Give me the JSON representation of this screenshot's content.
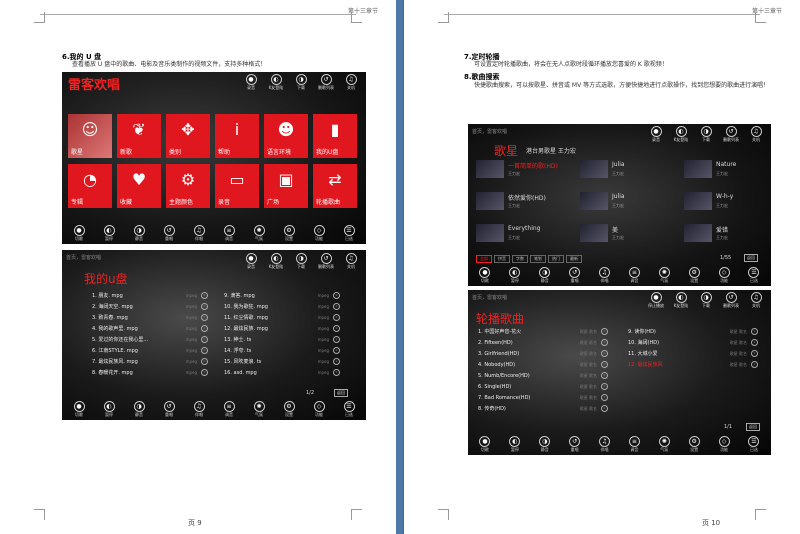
{
  "header_text": "第十三章节",
  "left_page": {
    "section_title": "6.我的 U 盘",
    "paragraph": "查看播放 U 盘中的歌曲、电影及音乐类制作的视频文件，支持多种格式！",
    "footer": "页 9",
    "shot1": {
      "title": "雷客欢唱",
      "top_icons": [
        "录音",
        "K友登陆",
        "下载",
        "删歌列表",
        "关机"
      ],
      "tiles": [
        {
          "label": "歌星",
          "sym": "☺"
        },
        {
          "label": "新歌",
          "sym": "❦"
        },
        {
          "label": "类别",
          "sym": "✥"
        },
        {
          "label": "帮助",
          "sym": "i"
        },
        {
          "label": "语言环境",
          "sym": "☻"
        },
        {
          "label": "我的U盘",
          "sym": "▮"
        },
        {
          "label": "专辑",
          "sym": "◔"
        },
        {
          "label": "收藏",
          "sym": "♥"
        },
        {
          "label": "主题颜色",
          "sym": "⚙"
        },
        {
          "label": "录音",
          "sym": "▭"
        },
        {
          "label": "广场",
          "sym": "▣"
        },
        {
          "label": "轮播歌曲",
          "sym": "⇄"
        }
      ],
      "bottom_icons": [
        "切歌",
        "暂停",
        "静音",
        "重唱",
        "伴唱",
        "调音",
        "气氛",
        "设置",
        "功能",
        "已选"
      ]
    },
    "shot2": {
      "crumb": "首页，雷客欢唱",
      "heading": "我的u盘",
      "top_icons": [
        "录音",
        "K友登陆",
        "下载",
        "删歌列表",
        "关机"
      ],
      "left_items": [
        "1. 朋友. mpg",
        "2. 海阔天空. mpg",
        "3. 致青春. mpg",
        "4. 我的歌声里. mpg",
        "5. 爱过的你还在我心里...",
        "6. 江南STYLE. mpg",
        "7. 最炫民族风. mpg",
        "8. 春暖花开. mpg"
      ],
      "right_items": [
        "9. 滴答. mpg",
        "10. 我为歌狂. mpg",
        "11. 红尘情歌. mpg",
        "12. 最炫民族. mpg",
        "13. 绅士. ts",
        "14. 浮夸. ts",
        "15. 风吹麦浪. ts",
        "16. asd. mpg"
      ],
      "tag": "mpeg",
      "pager": "1/2",
      "back": "返回",
      "bottom_icons": [
        "切歌",
        "暂停",
        "静音",
        "重唱",
        "伴唱",
        "调音",
        "气氛",
        "设置",
        "功能",
        "已选"
      ]
    }
  },
  "right_page": {
    "section7_title": "7.定时轮播",
    "section7_text": "可设置定时轮播歌曲，将会在无人点歌时段循环播放您喜爱的 K 歌视频！",
    "section8_title": "8.歌曲搜索",
    "section8_text": "快捷歌曲搜索，可以按歌星、拼音或 MV 等方式选歌，方便快捷地进行点歌操作，找到您想要的歌曲进行演唱！",
    "footer": "页 10",
    "shot3": {
      "crumb": "首页，雷客欢唱",
      "heading": "歌星",
      "sub": "港台男歌星  王力宏",
      "top_icons": [
        "录音",
        "K友登陆",
        "下载",
        "删歌列表",
        "关机"
      ],
      "songs": [
        {
          "name": "一首简单的歌(HD)",
          "singer": "王力宏",
          "highlight": true
        },
        {
          "name": "Julia",
          "singer": "王力宏",
          "highlight": false
        },
        {
          "name": "Nature",
          "singer": "王力宏",
          "highlight": false
        },
        {
          "name": "依然爱你(HD)",
          "singer": "王力宏",
          "highlight": false
        },
        {
          "name": "Julia",
          "singer": "王力宏",
          "highlight": false
        },
        {
          "name": "W-h-y",
          "singer": "王力宏",
          "highlight": false
        },
        {
          "name": "Everything",
          "singer": "王力宏",
          "highlight": false
        },
        {
          "name": "美",
          "singer": "王力宏",
          "highlight": false
        },
        {
          "name": "爱错",
          "singer": "王力宏",
          "highlight": false
        }
      ],
      "tabs": [
        "全部",
        "拼音",
        "字数",
        "笔划",
        "热门",
        "最新"
      ],
      "pager": "1/55",
      "back": "返回",
      "bottom_icons": [
        "切歌",
        "暂停",
        "静音",
        "重唱",
        "伴唱",
        "调音",
        "气氛",
        "设置",
        "功能",
        "已选"
      ]
    },
    "shot4": {
      "crumb": "首页，雷客欢唱",
      "heading": "轮播歌曲",
      "top_icons": [
        "停止播放",
        "K友登陆",
        "下载",
        "删歌列表",
        "关机"
      ],
      "left_items": [
        "1. 中国好声音-花火",
        "2. Fifteen(HD)",
        "3. Girlfriend(HD)",
        "4. Nobody(HD)",
        "5. Numb/Encore(HD)",
        "6. Single(HD)",
        "7. Bad Romance(HD)",
        "8. 传奇(HD)"
      ],
      "right_items": [
        "9. 读你(HD)",
        "10. 海阔(HD)",
        "11. 大城小爱",
        "12. 最炫民族风"
      ],
      "tag": "歌星 歌名",
      "pager": "1/1",
      "back": "返回",
      "bottom_icons": [
        "切歌",
        "暂停",
        "静音",
        "重唱",
        "伴唱",
        "调音",
        "气氛",
        "设置",
        "功能",
        "已选"
      ]
    }
  }
}
